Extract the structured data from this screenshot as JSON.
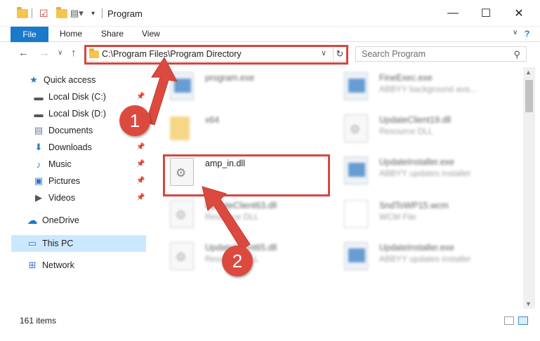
{
  "window": {
    "title": "Program"
  },
  "ribbon": {
    "file": "File",
    "home": "Home",
    "share": "Share",
    "view": "View"
  },
  "address": {
    "path": "C:\\Program Files\\Program Directory"
  },
  "search": {
    "placeholder": "Search Program"
  },
  "sidebar": {
    "quick_access": "Quick access",
    "items": [
      {
        "label": "Local Disk (C:)",
        "icon": "drive-icon",
        "pinned": true
      },
      {
        "label": "Local Disk (D:)",
        "icon": "drive-icon",
        "pinned": false
      },
      {
        "label": "Documents",
        "icon": "documents-icon",
        "pinned": true
      },
      {
        "label": "Downloads",
        "icon": "downloads-icon",
        "pinned": true
      },
      {
        "label": "Music",
        "icon": "music-icon",
        "pinned": true
      },
      {
        "label": "Pictures",
        "icon": "pictures-icon",
        "pinned": true
      },
      {
        "label": "Videos",
        "icon": "videos-icon",
        "pinned": true
      }
    ],
    "onedrive": "OneDrive",
    "thispc": "This PC",
    "network": "Network"
  },
  "files": [
    {
      "name": "program.exe",
      "desc": "",
      "icon": "exe-icon"
    },
    {
      "name": "FineExec.exe",
      "desc": "ABBYY background ava...",
      "icon": "exe-icon"
    },
    {
      "name": "x64",
      "desc": "",
      "icon": "folder-icon"
    },
    {
      "name": "UpdateClient19.dll",
      "desc": "Resource DLL",
      "icon": "dll-icon"
    },
    {
      "name": "amp_in.dll",
      "desc": "",
      "icon": "dll-icon"
    },
    {
      "name": "UpdateInstaller.exe",
      "desc": "ABBYY updates installer",
      "icon": "exe-icon"
    },
    {
      "name": "UpdateClient63.dll",
      "desc": "Resource DLL",
      "icon": "dll-icon"
    },
    {
      "name": "SndToWP15.wcm",
      "desc": "WCM File",
      "icon": "file-icon"
    },
    {
      "name": "UpdateClient65.dll",
      "desc": "Resource DLL",
      "icon": "dll-icon"
    },
    {
      "name": "UpdateInstaller.exe",
      "desc": "ABBYY updates installer",
      "icon": "exe-icon"
    }
  ],
  "status": {
    "count": "161 items"
  },
  "annotations": {
    "step1": "1",
    "step2": "2"
  },
  "colors": {
    "accent": "#1979ca",
    "highlight": "#d9453f",
    "selection": "#cce8ff"
  }
}
